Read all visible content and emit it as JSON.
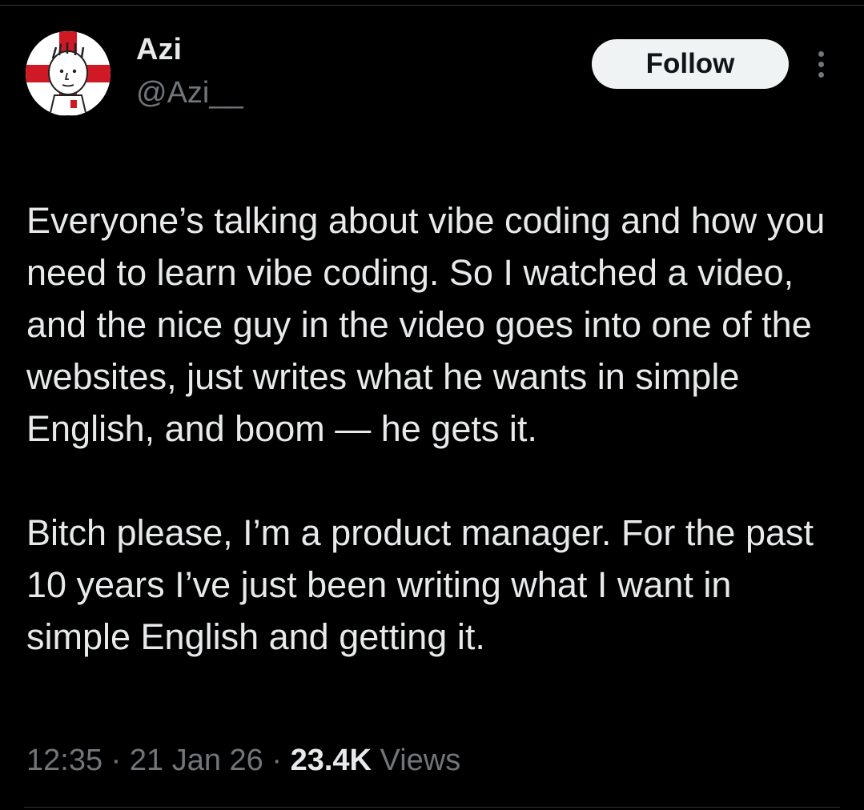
{
  "author": {
    "display_name": "Azi",
    "handle": "@Azi__"
  },
  "actions": {
    "follow_label": "Follow",
    "more_icon": "more-vertical-icon"
  },
  "tweet": {
    "paragraphs": [
      "Everyone’s talking about vibe coding and how you need to learn vibe coding. So I watched a video, and the nice guy in the video goes into one of the websites, just writes what he wants in simple English, and boom — he gets it.",
      "Bitch please, I’m a product manager. For the past 10 years I’ve just been writing what I want in simple English and getting it."
    ]
  },
  "meta": {
    "time": "12:35",
    "separator": "·",
    "date": "21 Jan 26",
    "views_count": "23.4K",
    "views_label": "Views"
  },
  "colors": {
    "background": "#000000",
    "primary_text": "#e7e9ea",
    "secondary_text": "#71767b",
    "follow_bg": "#eff3f4",
    "follow_text": "#0f1419",
    "avatar_flag_red": "#cf1a26"
  }
}
